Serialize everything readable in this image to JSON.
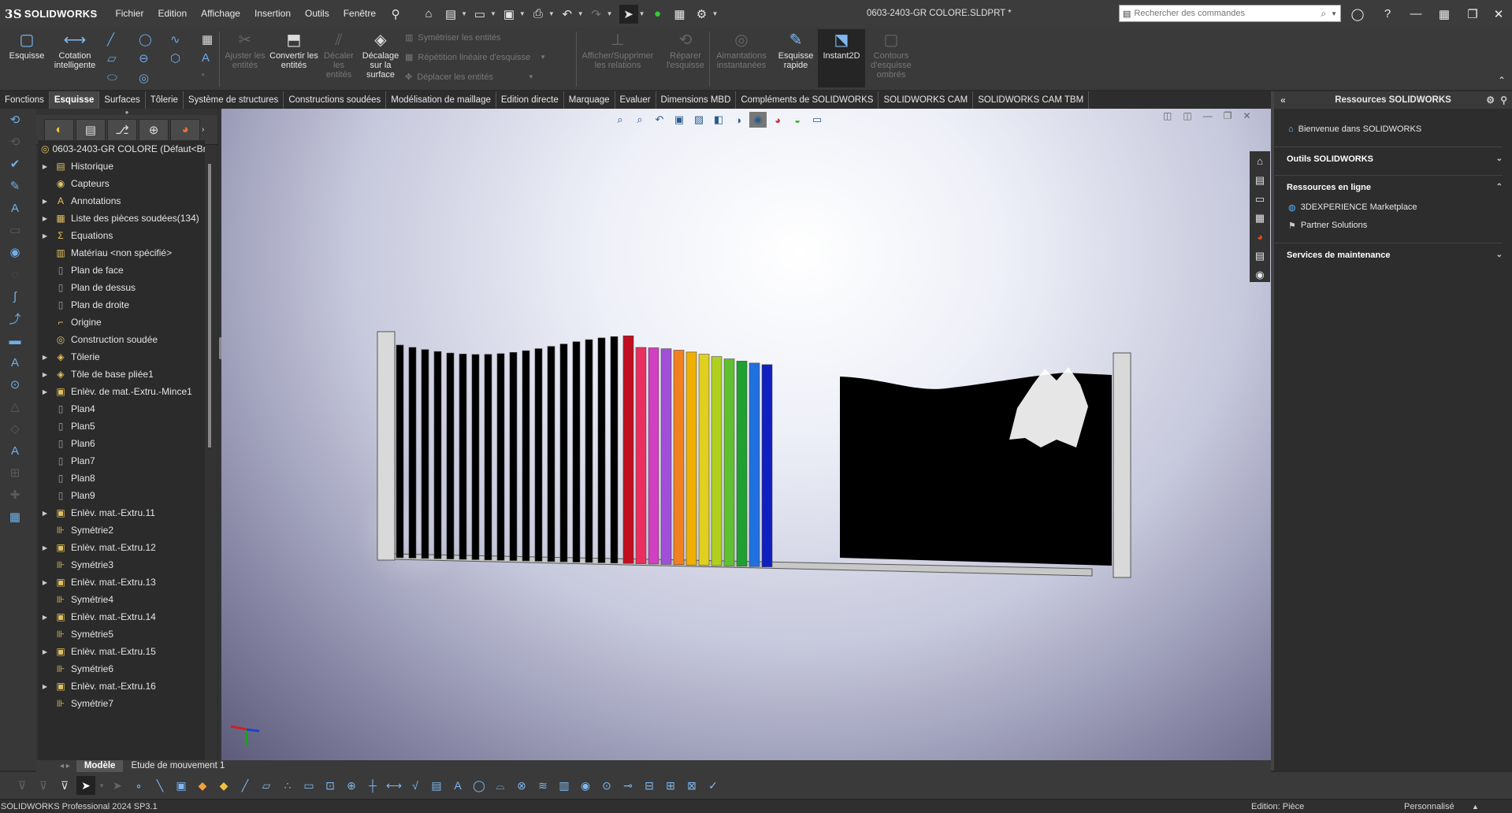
{
  "app": {
    "brand": "SOLIDWORKS",
    "brand_prefix": "3S"
  },
  "menu": [
    "Fichier",
    "Edition",
    "Affichage",
    "Insertion",
    "Outils",
    "Fenêtre"
  ],
  "document_title": "0603-2403-GR COLORE.SLDPRT *",
  "search": {
    "placeholder": "Rechercher des commandes"
  },
  "ribbon": {
    "esquisse": "Esquisse",
    "cotation": "Cotation intelligente",
    "ajuster": "Ajuster les entités",
    "convertir": "Convertir les entités",
    "decaler": "Décaler les entités",
    "decalage_surface": "Décalage sur la surface",
    "symetriser": "Symétriser les entités",
    "repetition": "Répétition linéaire d'esquisse",
    "deplacer": "Déplacer les entités",
    "afficher_relations": "Afficher/Supprimer les relations",
    "reparer": "Réparer l'esquisse",
    "aimantations": "Aimantations instantanées",
    "esquisse_rapide": "Esquisse rapide",
    "instant2d": "Instant2D",
    "contours": "Contours d'esquisse ombrés"
  },
  "tabs": [
    "Fonctions",
    "Esquisse",
    "Surfaces",
    "Tôlerie",
    "Système de structures",
    "Constructions soudées",
    "Modélisation de maillage",
    "Edition directe",
    "Marquage",
    "Evaluer",
    "Dimensions MBD",
    "Compléments de SOLIDWORKS",
    "SOLIDWORKS CAM",
    "SOLIDWORKS CAM TBM"
  ],
  "active_tab": "Esquisse",
  "tree": {
    "root": "0603-2403-GR COLORE (Défaut<Br",
    "items": [
      {
        "label": "Historique",
        "icon": "folder-icon",
        "expandable": true
      },
      {
        "label": "Capteurs",
        "icon": "sensor-icon",
        "expandable": false
      },
      {
        "label": "Annotations",
        "icon": "annotation-icon",
        "expandable": true
      },
      {
        "label": "Liste des pièces soudées(134)",
        "icon": "cut-list-icon",
        "expandable": true
      },
      {
        "label": "Equations",
        "icon": "equation-icon",
        "expandable": true
      },
      {
        "label": "Matériau <non spécifié>",
        "icon": "material-icon",
        "expandable": false
      },
      {
        "label": "Plan de face",
        "icon": "plane-icon",
        "expandable": false
      },
      {
        "label": "Plan de dessus",
        "icon": "plane-icon",
        "expandable": false
      },
      {
        "label": "Plan de droite",
        "icon": "plane-icon",
        "expandable": false
      },
      {
        "label": "Origine",
        "icon": "origin-icon",
        "expandable": false
      },
      {
        "label": "Construction soudée",
        "icon": "weldment-icon",
        "expandable": false
      },
      {
        "label": "Tôlerie",
        "icon": "sheetmetal-icon",
        "expandable": true
      },
      {
        "label": "Tôle de base pliée1",
        "icon": "sheetmetal-icon",
        "expandable": true
      },
      {
        "label": "Enlèv. de mat.-Extru.-Mince1",
        "icon": "cut-icon",
        "expandable": true
      },
      {
        "label": "Plan4",
        "icon": "plane-icon",
        "expandable": false
      },
      {
        "label": "Plan5",
        "icon": "plane-icon",
        "expandable": false
      },
      {
        "label": "Plan6",
        "icon": "plane-icon",
        "expandable": false
      },
      {
        "label": "Plan7",
        "icon": "plane-icon",
        "expandable": false
      },
      {
        "label": "Plan8",
        "icon": "plane-icon",
        "expandable": false
      },
      {
        "label": "Plan9",
        "icon": "plane-icon",
        "expandable": false
      },
      {
        "label": "Enlèv. mat.-Extru.11",
        "icon": "cut-icon",
        "expandable": true
      },
      {
        "label": "Symétrie2",
        "icon": "mirror-icon",
        "expandable": false
      },
      {
        "label": "Enlèv. mat.-Extru.12",
        "icon": "cut-icon",
        "expandable": true
      },
      {
        "label": "Symétrie3",
        "icon": "mirror-icon",
        "expandable": false
      },
      {
        "label": "Enlèv. mat.-Extru.13",
        "icon": "cut-icon",
        "expandable": true
      },
      {
        "label": "Symétrie4",
        "icon": "mirror-icon",
        "expandable": false
      },
      {
        "label": "Enlèv. mat.-Extru.14",
        "icon": "cut-icon",
        "expandable": true
      },
      {
        "label": "Symétrie5",
        "icon": "mirror-icon",
        "expandable": false
      },
      {
        "label": "Enlèv. mat.-Extru.15",
        "icon": "cut-icon",
        "expandable": true
      },
      {
        "label": "Symétrie6",
        "icon": "mirror-icon",
        "expandable": false
      },
      {
        "label": "Enlèv. mat.-Extru.16",
        "icon": "cut-icon",
        "expandable": true
      },
      {
        "label": "Symétrie7",
        "icon": "mirror-icon",
        "expandable": false
      }
    ]
  },
  "resources": {
    "header": "Ressources SOLIDWORKS",
    "welcome": "Bienvenue dans SOLIDWORKS",
    "outils": "Outils SOLIDWORKS",
    "en_ligne": "Ressources en ligne",
    "marketplace": "3DEXPERIENCE Marketplace",
    "partner": "Partner Solutions",
    "maintenance": "Services de maintenance"
  },
  "model_tabs": [
    "Modèle",
    "Etude de mouvement 1"
  ],
  "active_model_tab": "Modèle",
  "status": {
    "version": "SOLIDWORKS Professional 2024 SP3.1",
    "mode": "Edition: Pièce",
    "custom": "Personnalisé"
  },
  "colors": {
    "bar_colors": [
      "#000000",
      "#c01020",
      "#e83060",
      "#d040c0",
      "#a050d8",
      "#f08020",
      "#f0b000",
      "#e0d020",
      "#b0d020",
      "#60c030",
      "#20a030",
      "#2070e0",
      "#1020c0",
      "#000000"
    ]
  }
}
